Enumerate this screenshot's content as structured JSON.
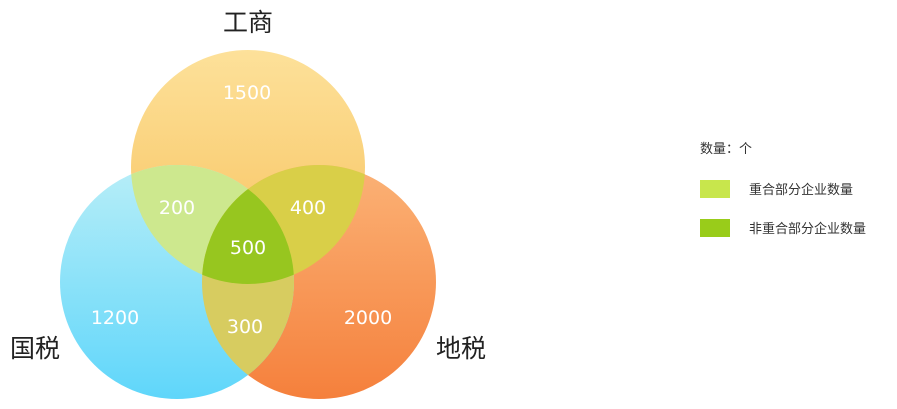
{
  "chart_data": {
    "type": "venn",
    "sets": [
      {
        "id": "gongshang",
        "name": "工商"
      },
      {
        "id": "guoshui",
        "name": "国税"
      },
      {
        "id": "dishui",
        "name": "地税"
      }
    ],
    "regions": [
      {
        "sets": [
          "gongshang"
        ],
        "value": "1500"
      },
      {
        "sets": [
          "guoshui"
        ],
        "value": "1200"
      },
      {
        "sets": [
          "dishui"
        ],
        "value": "2000"
      },
      {
        "sets": [
          "gongshang",
          "guoshui"
        ],
        "value": "200"
      },
      {
        "sets": [
          "gongshang",
          "dishui"
        ],
        "value": "400"
      },
      {
        "sets": [
          "guoshui",
          "dishui"
        ],
        "value": "300"
      },
      {
        "sets": [
          "gongshang",
          "guoshui",
          "dishui"
        ],
        "value": "500"
      }
    ]
  },
  "legend": {
    "title": "数量：个",
    "items": [
      {
        "label": "重合部分企业数量",
        "color": "#c8e64c"
      },
      {
        "label": "非重合部分企业数量",
        "color": "#99cc1a"
      }
    ]
  },
  "colors": {
    "gongshang_top": "#fde19a",
    "gongshang_bottom": "#f7c15c",
    "guoshui_top": "#b8eef8",
    "guoshui_bottom": "#5fd6fa",
    "dishui_top": "#fbb276",
    "dishui_bottom": "#f5803c",
    "overlap_gongshang_guoshui": "#cde88e",
    "overlap_gongshang_dishui": "#d9cf48",
    "overlap_guoshui_dishui": "#d7cc60",
    "overlap_all": "#97c61f"
  }
}
